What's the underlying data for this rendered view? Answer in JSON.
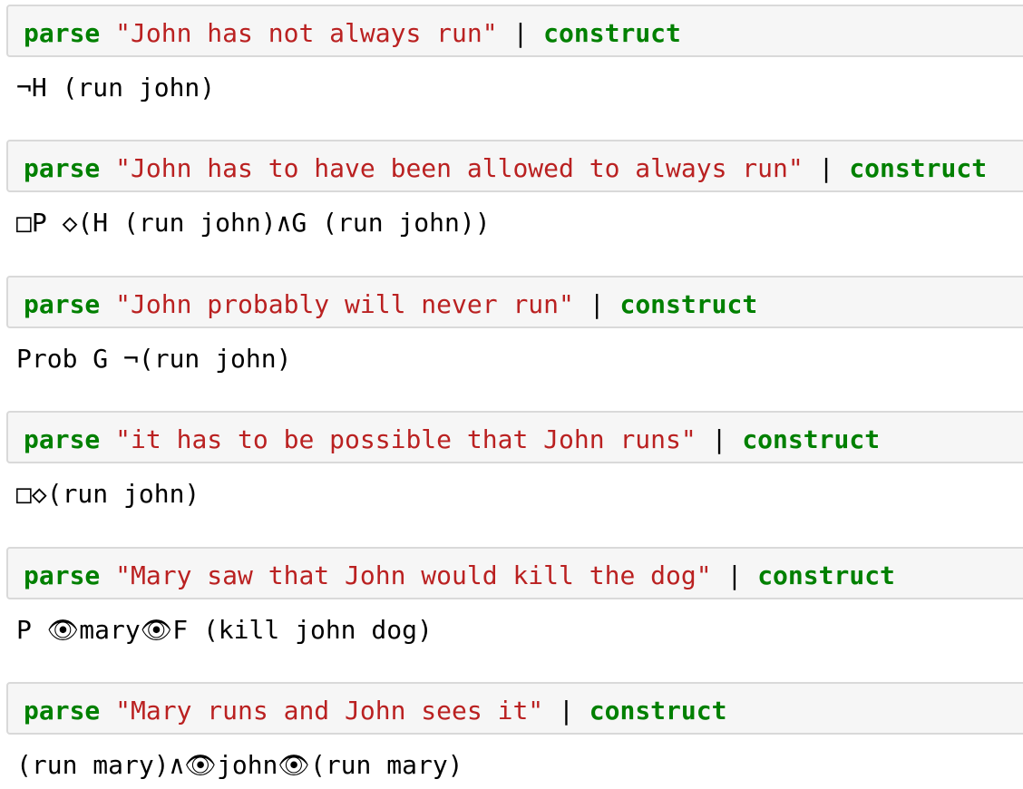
{
  "colors": {
    "keyword": "#008000",
    "string": "#ba2121",
    "text": "#000000",
    "cell_background": "#f6f6f6",
    "cell_border": "#d9d9d9"
  },
  "cells": [
    {
      "keyword1": "parse",
      "string": "\"John has not always run\"",
      "pipe": "|",
      "keyword2": "construct",
      "output": "¬H (run john)"
    },
    {
      "keyword1": "parse",
      "string": "\"John has to have been allowed to always run\"",
      "pipe": "|",
      "keyword2": "construct",
      "output": "□P ◇(H (run john)∧G (run john))"
    },
    {
      "keyword1": "parse",
      "string": "\"John probably will never run\"",
      "pipe": "|",
      "keyword2": "construct",
      "output": "Prob G ¬(run john)"
    },
    {
      "keyword1": "parse",
      "string": "\"it has to be possible that John runs\"",
      "pipe": "|",
      "keyword2": "construct",
      "output": "□◇(run john)"
    },
    {
      "keyword1": "parse",
      "string": "\"Mary saw that John would kill the dog\"",
      "pipe": "|",
      "keyword2": "construct",
      "output": "P 👁mary👁F (kill john dog)"
    },
    {
      "keyword1": "parse",
      "string": "\"Mary runs and John sees it\"",
      "pipe": "|",
      "keyword2": "construct",
      "output": "(run mary)∧👁john👁(run mary)"
    }
  ]
}
